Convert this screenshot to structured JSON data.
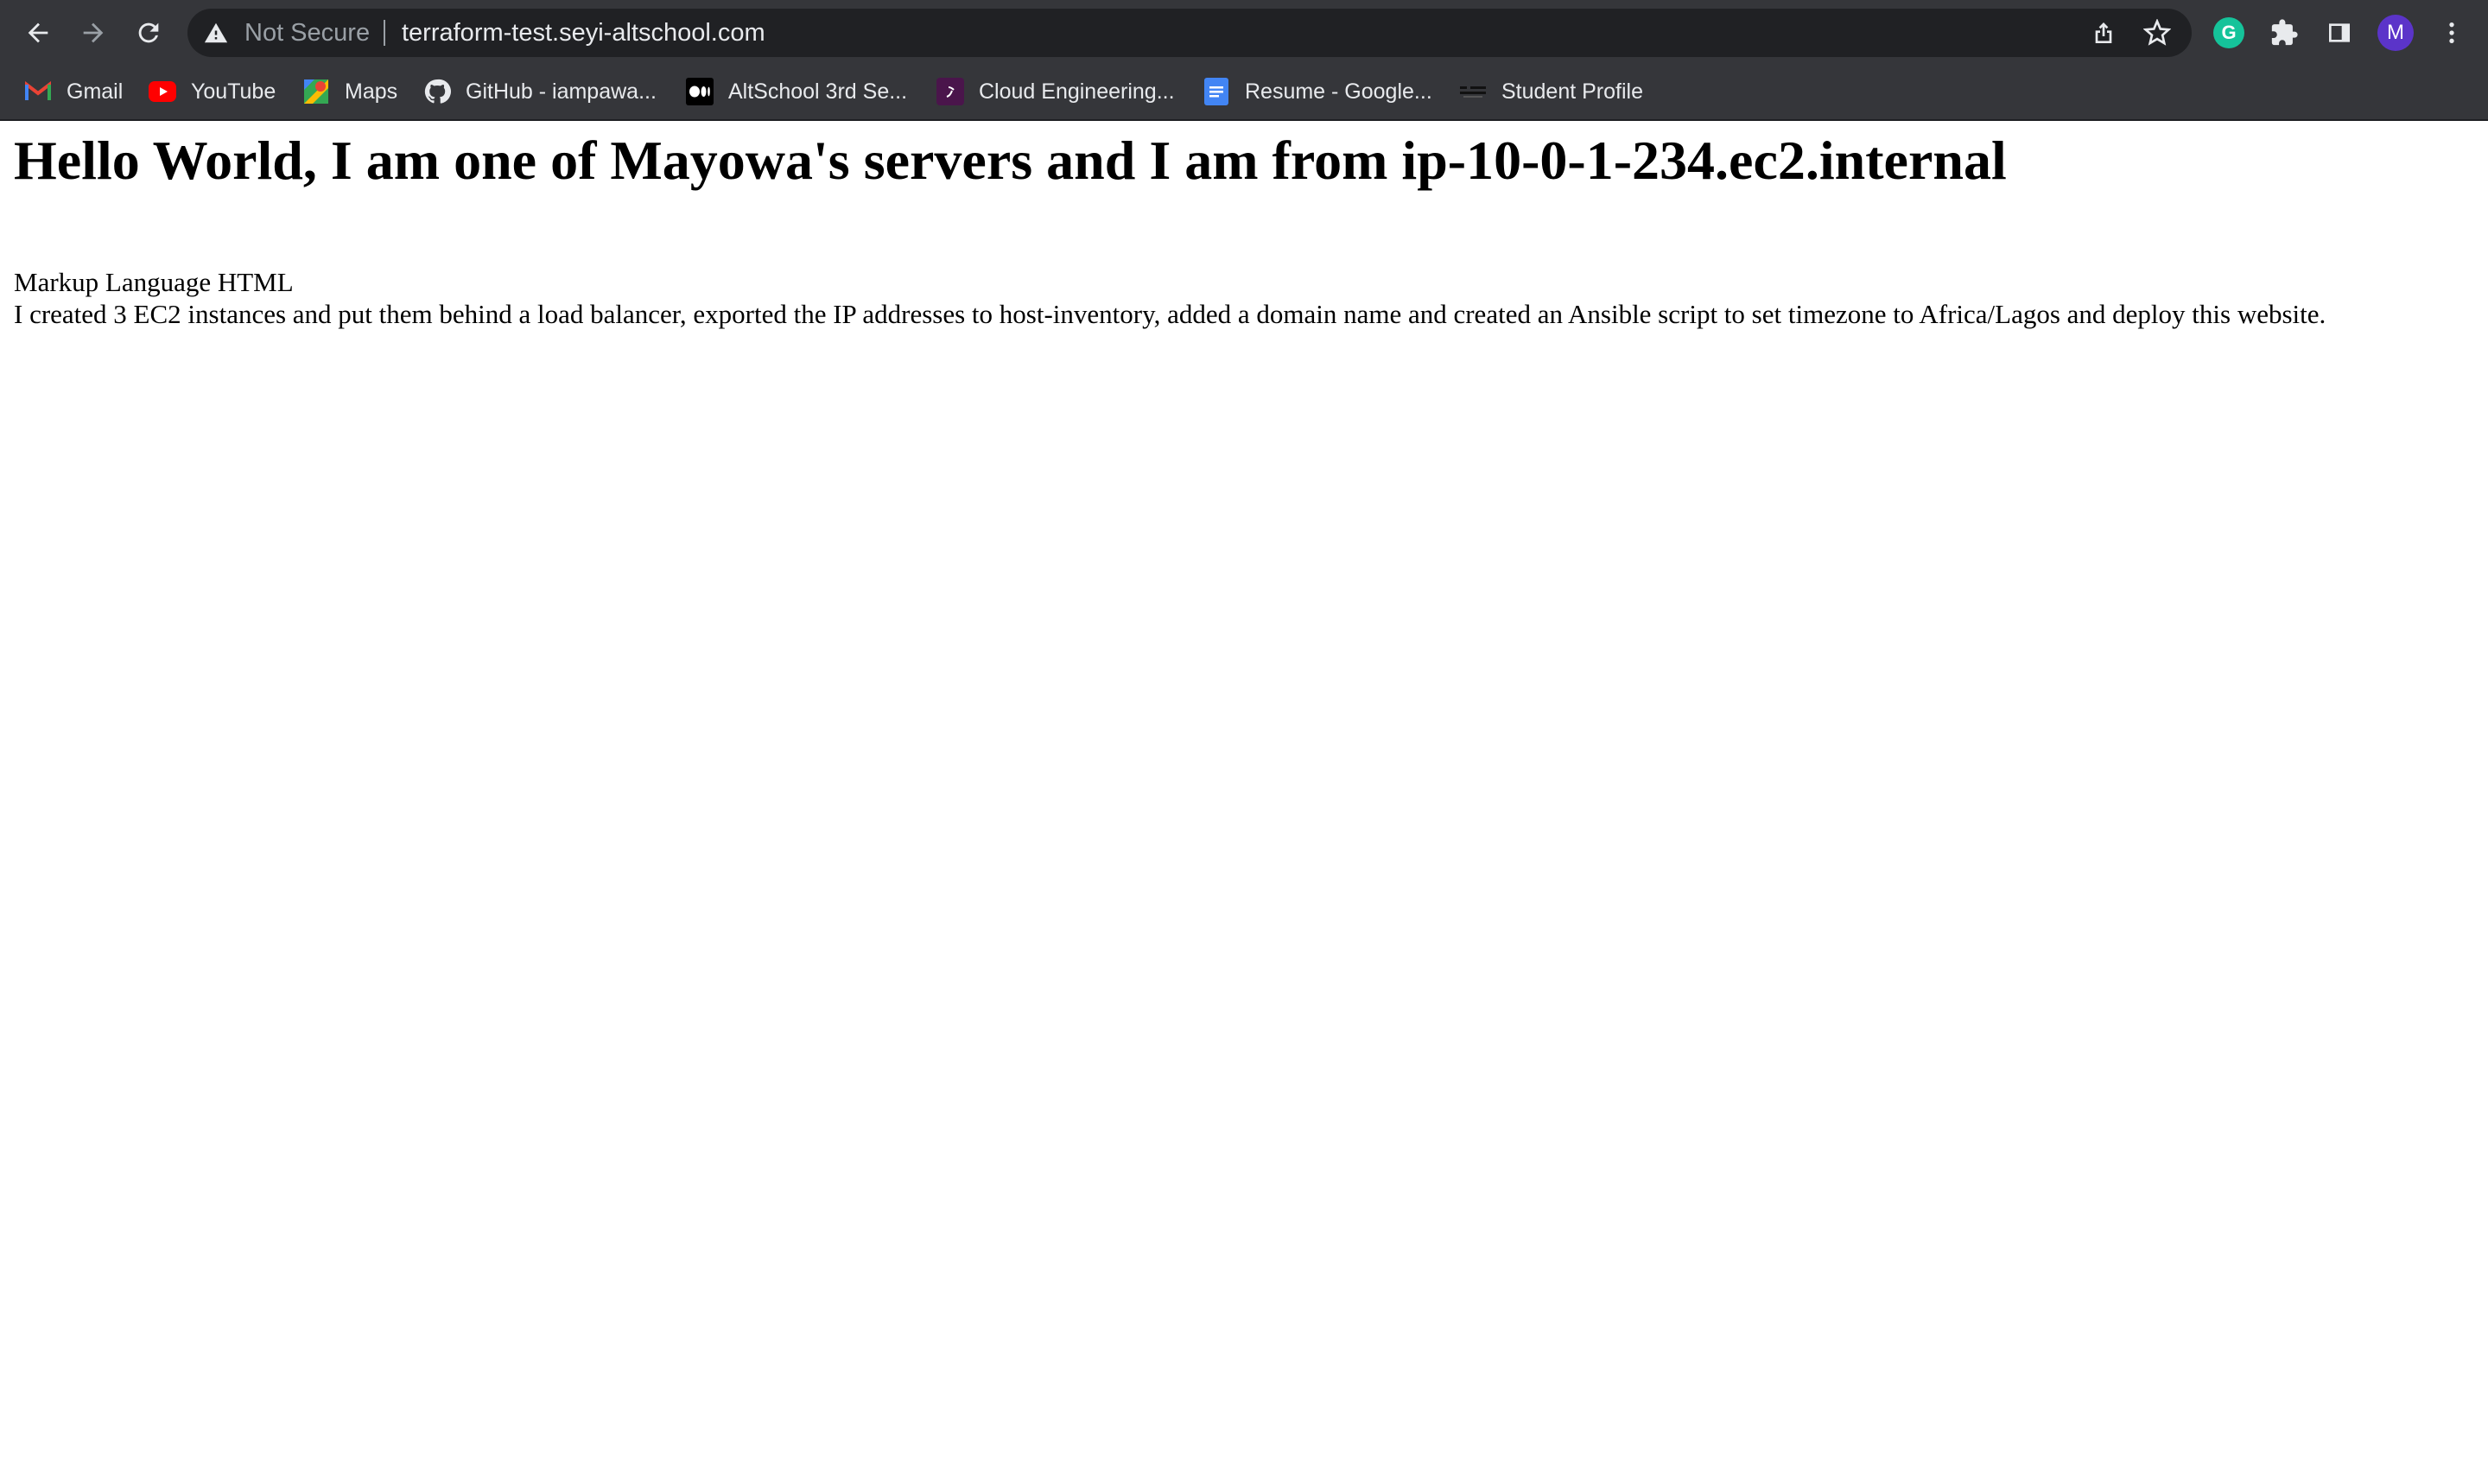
{
  "browser": {
    "security_status": "Not Secure",
    "url": "terraform-test.seyi-altschool.com",
    "profile_initial": "M",
    "grammarly_initial": "G",
    "icons": {
      "back": "arrow-left-icon",
      "forward": "arrow-right-icon",
      "reload": "reload-icon",
      "warning": "warning-triangle-icon",
      "share": "share-icon",
      "bookmark": "star-icon",
      "extensions": "puzzle-icon",
      "side_panel": "side-panel-icon",
      "menu": "kebab-menu-icon"
    },
    "colors": {
      "chrome_bg": "#35363a",
      "omnibox_bg": "#202124",
      "text": "#e8eaed",
      "muted": "#9aa0a6",
      "avatar": "#5b34c9",
      "grammarly": "#15c39a"
    }
  },
  "bookmarks": [
    {
      "label": "Gmail",
      "icon": "gmail-icon"
    },
    {
      "label": "YouTube",
      "icon": "youtube-icon"
    },
    {
      "label": "Maps",
      "icon": "maps-icon"
    },
    {
      "label": "GitHub - iampawa...",
      "icon": "github-icon"
    },
    {
      "label": "AltSchool 3rd Se...",
      "icon": "medium-icon"
    },
    {
      "label": "Cloud Engineering...",
      "icon": "slack-icon"
    },
    {
      "label": "Resume - Google...",
      "icon": "google-docs-icon"
    },
    {
      "label": "Student Profile",
      "icon": "altschool-icon"
    }
  ],
  "page": {
    "heading": "Hello World, I am one of Mayowa's servers and I am from ip-10-0-1-234.ec2.internal",
    "line1": "Markup Language HTML",
    "line2": "I created 3 EC2 instances and put them behind a load balancer, exported the IP addresses to host-inventory, added a domain name and created an Ansible script to set timezone to Africa/Lagos and deploy this website."
  }
}
